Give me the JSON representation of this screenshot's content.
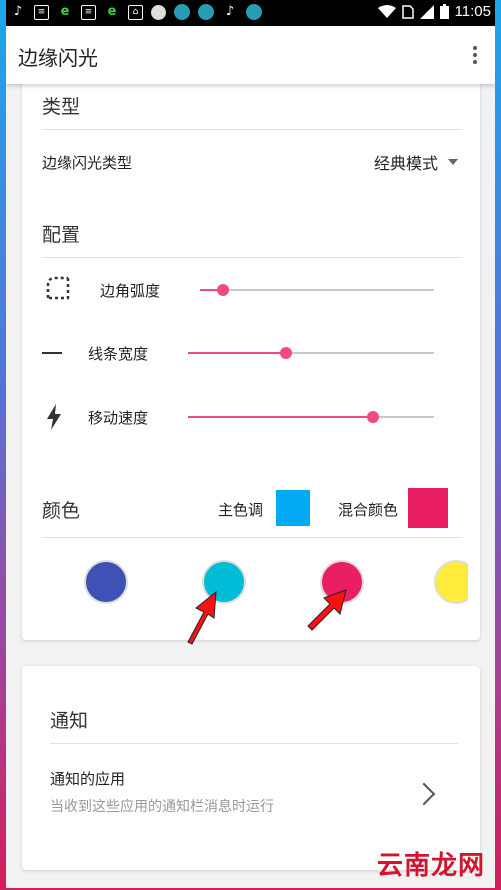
{
  "status_bar": {
    "time": "11:05",
    "icons": [
      "music-note-icon",
      "document-icon",
      "browser-e-icon",
      "document-icon",
      "browser-e-icon",
      "app-icon",
      "circle-app-icon",
      "teal-app-icon",
      "teal-app-icon",
      "tiktok-icon",
      "teal-app-icon"
    ],
    "right_icons": [
      "wifi-icon",
      "sim-icon",
      "signal-icon",
      "battery-icon"
    ]
  },
  "app_bar": {
    "title": "边缘闪光",
    "menu_icon": "more-vert-icon"
  },
  "type_section": {
    "title": "类型",
    "row_label": "边缘闪光类型",
    "dropdown_value": "经典模式"
  },
  "config_section": {
    "title": "配置",
    "sliders": [
      {
        "label": "边角弧度",
        "icon": "rounded-corner-icon",
        "value": 0.1
      },
      {
        "label": "线条宽度",
        "icon": "line-width-icon",
        "value": 0.4
      },
      {
        "label": "移动速度",
        "icon": "lightning-icon",
        "value": 0.75
      }
    ]
  },
  "color_section": {
    "title": "颜色",
    "primary_label": "主色调",
    "primary_color": "#03a9f4",
    "mix_label": "混合颜色",
    "mix_color": "#e91e63",
    "palette": [
      "#3f51b5",
      "#00bcd4",
      "#e91e63",
      "#ffeb3b"
    ]
  },
  "notify_section": {
    "title": "通知",
    "item_title": "通知的应用",
    "item_subtitle": "当收到这些应用的通知栏消息时运行"
  },
  "watermark": "云南龙网",
  "accent_color": "#ef4a86"
}
